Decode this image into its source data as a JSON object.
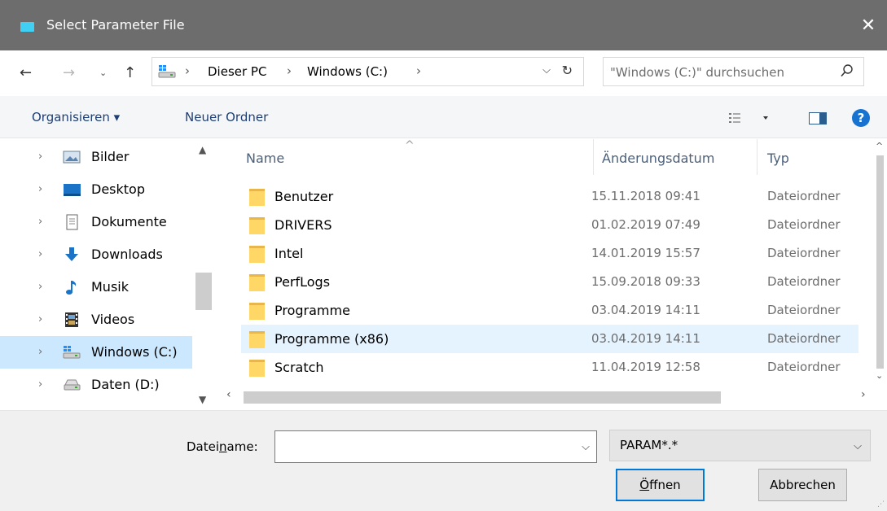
{
  "window": {
    "title": "Select Parameter File",
    "close_glyph": "✕"
  },
  "address": {
    "crumbs": [
      "Dieser PC",
      "Windows (C:)"
    ],
    "search_placeholder": "\"Windows (C:)\" durchsuchen"
  },
  "toolbar": {
    "organize_label": "Organisieren ▾",
    "new_folder_label": "Neuer Ordner",
    "help_label": "?"
  },
  "nav": {
    "items": [
      {
        "label": "Bilder",
        "icon": "pictures-icon"
      },
      {
        "label": "Desktop",
        "icon": "desktop-icon"
      },
      {
        "label": "Dokumente",
        "icon": "documents-icon"
      },
      {
        "label": "Downloads",
        "icon": "downloads-icon"
      },
      {
        "label": "Musik",
        "icon": "music-icon"
      },
      {
        "label": "Videos",
        "icon": "videos-icon"
      },
      {
        "label": "Windows (C:)",
        "icon": "drive-windows-icon",
        "selected": true
      },
      {
        "label": "Daten (D:)",
        "icon": "drive-icon"
      }
    ]
  },
  "files": {
    "columns": {
      "name": "Name",
      "date": "Änderungsdatum",
      "type": "Typ"
    },
    "rows": [
      {
        "name": "Benutzer",
        "date": "15.11.2018 09:41",
        "type": "Dateiordner"
      },
      {
        "name": "DRIVERS",
        "date": "01.02.2019 07:49",
        "type": "Dateiordner"
      },
      {
        "name": "Intel",
        "date": "14.01.2019 15:57",
        "type": "Dateiordner"
      },
      {
        "name": "PerfLogs",
        "date": "15.09.2018 09:33",
        "type": "Dateiordner"
      },
      {
        "name": "Programme",
        "date": "03.04.2019 14:11",
        "type": "Dateiordner"
      },
      {
        "name": "Programme (x86)",
        "date": "03.04.2019 14:11",
        "type": "Dateiordner",
        "hover": true
      },
      {
        "name": "Scratch",
        "date": "11.04.2019 12:58",
        "type": "Dateiordner"
      }
    ]
  },
  "footer": {
    "filename_label_pre": "Datei",
    "filename_label_ul": "n",
    "filename_label_post": "ame:",
    "filename_value": "",
    "filter_value": "PARAM*.*",
    "open_label_ul": "Ö",
    "open_label_post": "ffnen",
    "cancel_label": "Abbrechen"
  },
  "colors": {
    "titlebar": "#6d6d6d",
    "selection": "#cce8ff",
    "hover": "#e5f3ff",
    "accent": "#0078d7",
    "folder": "#ffd767"
  }
}
